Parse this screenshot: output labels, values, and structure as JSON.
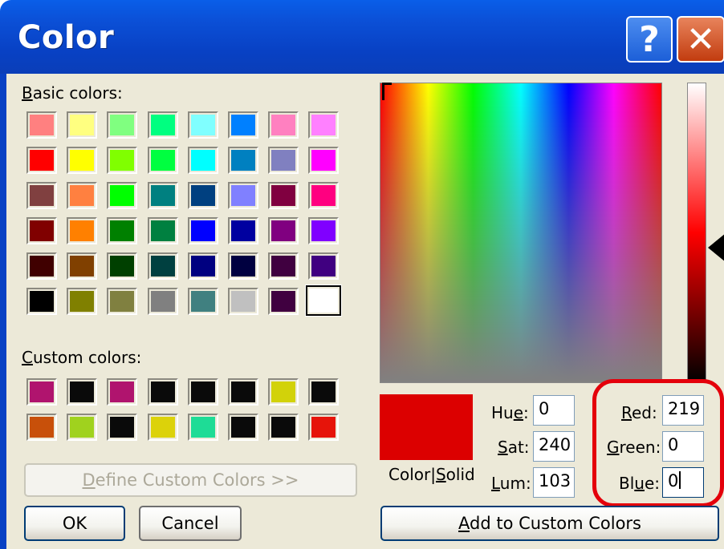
{
  "window": {
    "title": "Color",
    "help_glyph": "?",
    "close_glyph": "✕"
  },
  "colors": {
    "titlebar": "#0841c4",
    "dialog_bg": "#ece9d8",
    "close_button": "#c23c0f",
    "highlight_ring": "#e4000b",
    "color_solid": "#dc0000"
  },
  "basic_colors": {
    "label_pre": "",
    "label_mnemonic": "B",
    "label_post": "asic colors:",
    "swatches": [
      [
        "#ff8080",
        "#ffff80",
        "#80ff80",
        "#00ff80",
        "#80ffff",
        "#0080ff",
        "#ff80c0",
        "#ff80ff"
      ],
      [
        "#ff0000",
        "#ffff00",
        "#80ff00",
        "#00ff40",
        "#00ffff",
        "#0080c0",
        "#8080c0",
        "#ff00ff"
      ],
      [
        "#804040",
        "#ff8040",
        "#00ff00",
        "#008080",
        "#004080",
        "#8080ff",
        "#800040",
        "#ff0080"
      ],
      [
        "#800000",
        "#ff8000",
        "#008000",
        "#008040",
        "#0000ff",
        "#0000a0",
        "#800080",
        "#8000ff"
      ],
      [
        "#400000",
        "#804000",
        "#004000",
        "#004040",
        "#000080",
        "#000040",
        "#400040",
        "#400080"
      ],
      [
        "#000000",
        "#808000",
        "#808040",
        "#808080",
        "#408080",
        "#c0c0c0",
        "#400040",
        "#ffffff"
      ]
    ],
    "selected": "5-7"
  },
  "custom_colors": {
    "label_pre": "",
    "label_mnemonic": "C",
    "label_post": "ustom colors:",
    "swatches": [
      [
        "#b0146e",
        "#0a0a0a",
        "#b0146e",
        "#0a0a0a",
        "#0a0a0a",
        "#0a0a0a",
        "#d2d20a",
        "#0a0a0a"
      ],
      [
        "#c8500a",
        "#a0d21e",
        "#0a0a0a",
        "#dcd20a",
        "#1edc96",
        "#0a0a0a",
        "#0a0a0a",
        "#e6140a"
      ]
    ]
  },
  "buttons": {
    "define_pre": "",
    "define_mnemonic": "D",
    "define_post": "efine Custom Colors >>",
    "ok": "OK",
    "cancel": "Cancel",
    "add_pre": "",
    "add_mnemonic": "A",
    "add_post": "dd to Custom Colors"
  },
  "color_solid_label": {
    "pre": "Color|",
    "mnemonic": "S",
    "post": "olid"
  },
  "hsl": {
    "hue": {
      "pre": "Hu",
      "mnemonic": "e",
      "post": ":",
      "value": "0"
    },
    "sat": {
      "pre": "",
      "mnemonic": "S",
      "post": "at:",
      "value": "240"
    },
    "lum": {
      "pre": "",
      "mnemonic": "L",
      "post": "um:",
      "value": "103"
    }
  },
  "rgb": {
    "red": {
      "pre": "",
      "mnemonic": "R",
      "post": "ed:",
      "value": "219"
    },
    "green": {
      "pre": "",
      "mnemonic": "G",
      "post": "reen:",
      "value": "0"
    },
    "blue": {
      "pre": "Bl",
      "mnemonic": "u",
      "post": "e:",
      "value": "0"
    }
  },
  "luminosity_level": 0.55
}
